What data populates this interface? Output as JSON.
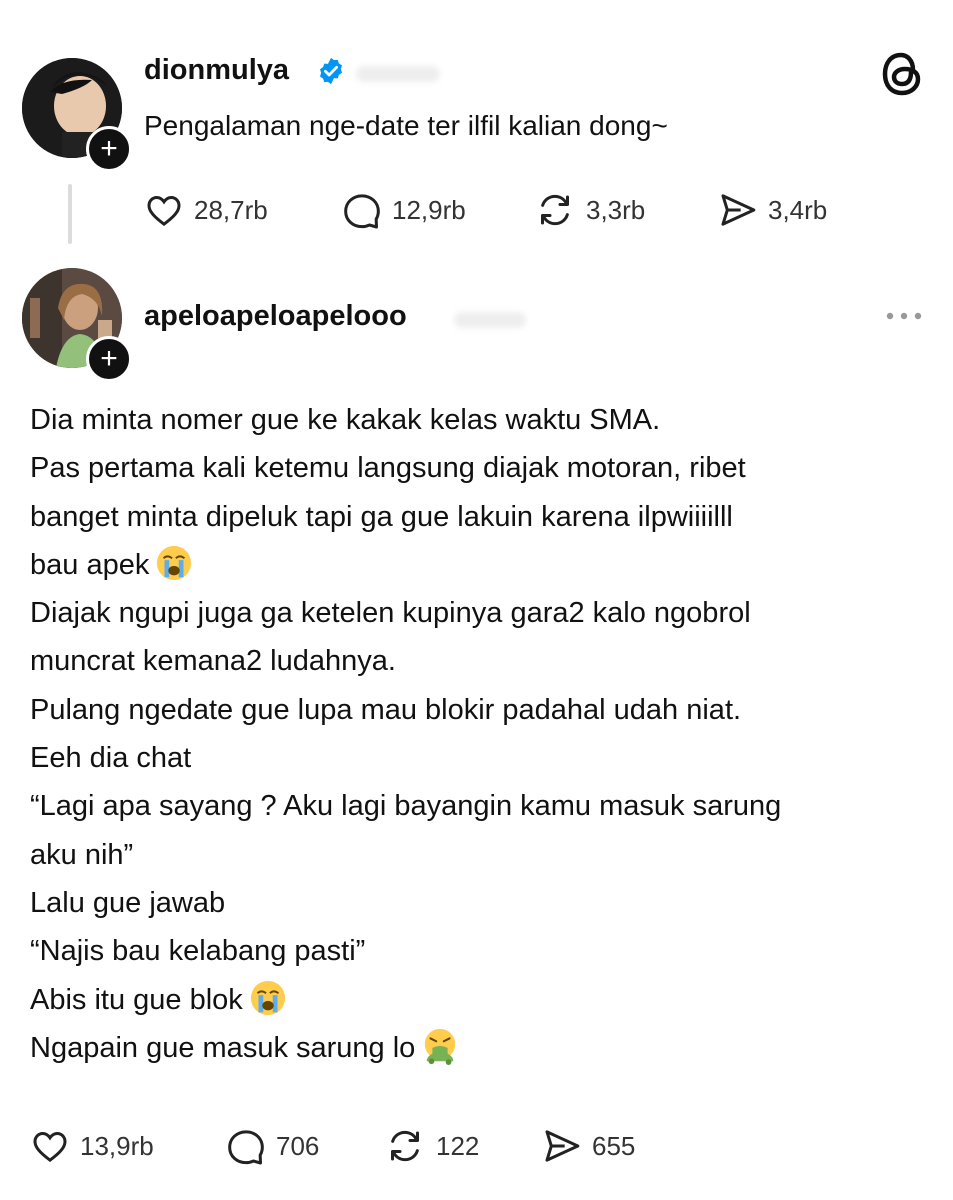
{
  "post": {
    "username": "dionmulya",
    "text": "Pengalaman nge-date ter ilfil kalian dong~",
    "stats": {
      "likes": "28,7rb",
      "replies": "12,9rb",
      "reposts": "3,3rb",
      "shares": "3,4rb"
    }
  },
  "reply": {
    "username": "apeloapeloapelooo",
    "lines": [
      "Dia minta nomer gue ke kakak kelas waktu SMA.",
      "Pas pertama kali ketemu langsung diajak motoran, ribet",
      "banget minta dipeluk tapi ga gue lakuin karena ilpwiiiilll",
      "bau apek",
      "Diajak ngupi juga ga ketelen kupinya gara2 kalo ngobrol",
      "muncrat kemana2 ludahnya.",
      "Pulang ngedate gue lupa mau blokir padahal udah niat.",
      "Eeh dia chat",
      "“Lagi apa sayang ? Aku lagi bayangin kamu masuk sarung",
      "aku nih”",
      "Lalu gue jawab",
      "“Najis bau kelabang pasti”",
      "Abis itu gue blok",
      "Ngapain gue masuk sarung lo"
    ],
    "stats": {
      "likes": "13,9rb",
      "replies": "706",
      "reposts": "122",
      "shares": "655"
    }
  },
  "icons": {
    "like": "heart-icon",
    "reply": "speech-bubble-icon",
    "repost": "repost-icon",
    "share": "send-icon",
    "follow": "plus-icon",
    "app": "threads-logo-icon",
    "more": "more-dots-icon",
    "verified": "verified-badge-icon",
    "emoji_cry": "loudly-crying-face-emoji",
    "emoji_vomit": "vomiting-face-emoji"
  },
  "colors": {
    "text": "#101010",
    "secondary": "#333333",
    "verified": "#0095f6",
    "divider": "#dcdcdc"
  }
}
